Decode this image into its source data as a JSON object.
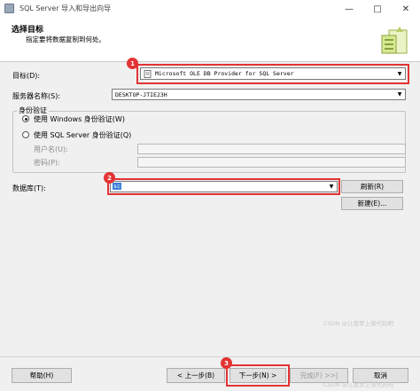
{
  "window": {
    "title": "SQL Server 导入和导出向导",
    "minimize": "—",
    "maximize": "□",
    "close": "✕"
  },
  "header": {
    "title": "选择目标",
    "subtitle": "指定要将数据复制到何处。"
  },
  "form": {
    "destination_label": "目标(D):",
    "destination_value": "Microsoft OLE DB Provider for SQL Server",
    "server_label": "服务器名称(S):",
    "server_value": "DESKTOP-JTIE23H",
    "auth_group_label": "身份验证",
    "auth_windows": "使用 Windows 身份验证(W)",
    "auth_sql": "使用 SQL Server 身份验证(Q)",
    "username_label": "用户名(U):",
    "password_label": "密码(P):",
    "database_label": "数据库(T):",
    "database_value": "sc",
    "refresh_button": "刷新(R)",
    "new_button": "新建(E)..."
  },
  "footer": {
    "help": "帮助(H)",
    "back": "< 上一步(B)",
    "next": "下一步(N) >",
    "finish": "完成(F) >>|",
    "cancel": "取消"
  },
  "annotations": {
    "marker1": "1",
    "marker2": "2",
    "marker3": "3",
    "color": "#e33333"
  },
  "watermark": "CSDN @让我梦上架代码吧"
}
